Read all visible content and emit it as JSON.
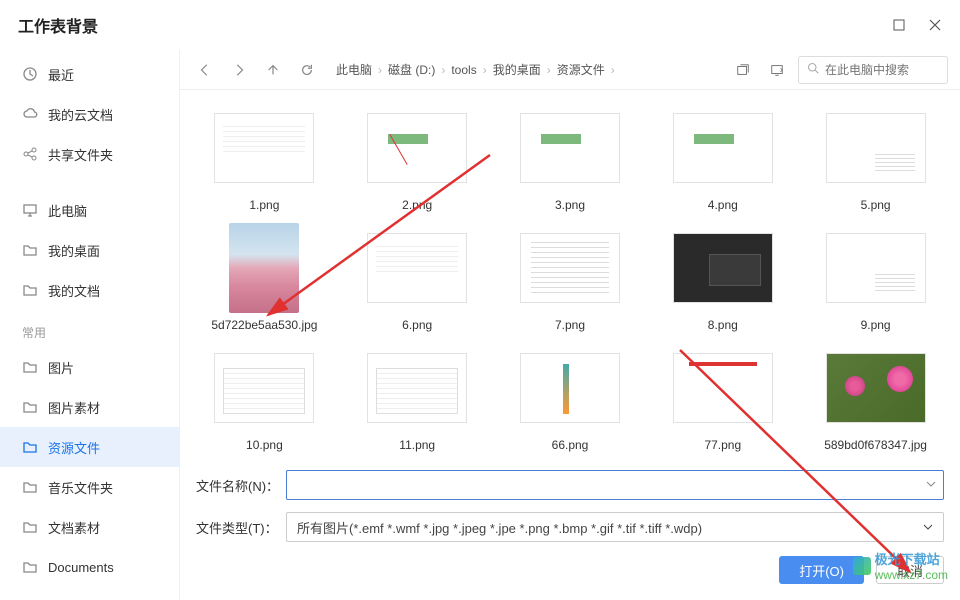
{
  "title": "工作表背景",
  "sidebar": {
    "items": [
      {
        "icon": "clock",
        "label": "最近"
      },
      {
        "icon": "cloud",
        "label": "我的云文档"
      },
      {
        "icon": "share",
        "label": "共享文件夹"
      }
    ],
    "places": [
      {
        "icon": "monitor",
        "label": "此电脑"
      },
      {
        "icon": "folder",
        "label": "我的桌面"
      },
      {
        "icon": "folder",
        "label": "我的文档"
      }
    ],
    "common_label": "常用",
    "common": [
      {
        "icon": "folder",
        "label": "图片"
      },
      {
        "icon": "folder",
        "label": "图片素材"
      },
      {
        "icon": "folder",
        "label": "资源文件",
        "active": true
      },
      {
        "icon": "folder",
        "label": "音乐文件夹"
      },
      {
        "icon": "folder",
        "label": "文档素材"
      },
      {
        "icon": "folder",
        "label": "Documents"
      }
    ]
  },
  "breadcrumb": [
    "此电脑",
    "磁盘 (D:)",
    "tools",
    "我的桌面",
    "资源文件"
  ],
  "search_placeholder": "在此电脑中搜索",
  "files": [
    {
      "name": "1.png",
      "kind": "sheet-white sheet-lines"
    },
    {
      "name": "2.png",
      "kind": "sheet-white sheet-green sheet-arrow"
    },
    {
      "name": "3.png",
      "kind": "sheet-white sheet-green"
    },
    {
      "name": "4.png",
      "kind": "sheet-white sheet-green"
    },
    {
      "name": "5.png",
      "kind": "sheet-white sheet-tiny"
    },
    {
      "name": "5d722be5aa530.jpg",
      "kind": "blossom1",
      "tall": true
    },
    {
      "name": "6.png",
      "kind": "sheet-white sheet-lines"
    },
    {
      "name": "7.png",
      "kind": "sheet-white sheet-doc"
    },
    {
      "name": "8.png",
      "kind": "sheet-dark"
    },
    {
      "name": "9.png",
      "kind": "sheet-white sheet-tiny"
    },
    {
      "name": "10.png",
      "kind": "sheet-white sheet-ui"
    },
    {
      "name": "11.png",
      "kind": "sheet-white sheet-ui"
    },
    {
      "name": "66.png",
      "kind": "sheet-white sheet-orange"
    },
    {
      "name": "77.png",
      "kind": "sheet-white sheet-red"
    },
    {
      "name": "589bd0f678347.jpg",
      "kind": "blossom2"
    }
  ],
  "filename_label": "文件名称(N)：",
  "filetype_label": "文件类型(T)：",
  "filename_value": "",
  "filetype_value": "所有图片(*.emf *.wmf *.jpg *.jpeg *.jpe *.png *.bmp *.gif *.tif *.tiff *.wdp)",
  "open_button": "打开(O)",
  "cancel_button": "取消",
  "watermark": {
    "brand": "极光下载站",
    "url": "www.xz7.com"
  }
}
